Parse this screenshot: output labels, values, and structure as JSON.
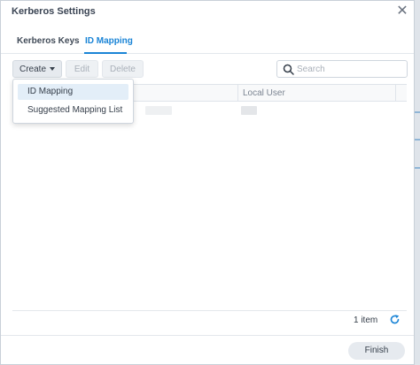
{
  "dialog": {
    "title": "Kerberos Settings",
    "close_glyph": "✕"
  },
  "tabs": [
    {
      "label": "Kerberos Keys",
      "active": false
    },
    {
      "label": "ID Mapping",
      "active": true
    }
  ],
  "toolbar": {
    "create_label": "Create",
    "edit_label": "Edit",
    "delete_label": "Delete"
  },
  "search": {
    "placeholder": "Search",
    "value": ""
  },
  "grid": {
    "columns": [
      "",
      "Local User"
    ],
    "rows": [
      {
        "kerberos_user": "",
        "local_user": ""
      }
    ]
  },
  "create_menu": {
    "items": [
      "ID Mapping",
      "Suggested Mapping List"
    ],
    "hovered_index": 0
  },
  "footer": {
    "item_count": "1 item",
    "finish_label": "Finish"
  },
  "colors": {
    "accent": "#1a84d6",
    "text": "#353e4a",
    "disabled": "#a9b0b9"
  }
}
